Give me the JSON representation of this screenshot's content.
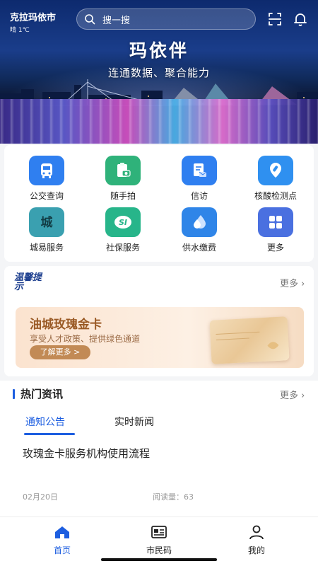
{
  "header": {
    "city": "克拉玛依市",
    "weather": "晴  1℃",
    "search_placeholder": "搜一搜"
  },
  "banner": {
    "title": "玛依伴",
    "subtitle": "连通数据、聚合能力"
  },
  "services": [
    {
      "label": "公交查询",
      "icon": "bus-icon",
      "color": "#2f7ff0"
    },
    {
      "label": "随手拍",
      "icon": "camera-clipboard-icon",
      "color": "#2fb27a"
    },
    {
      "label": "信访",
      "icon": "letter-icon",
      "color": "#2f7ff0"
    },
    {
      "label": "核酸检测点",
      "icon": "test-tube-location-icon",
      "color": "#2f90f0"
    },
    {
      "label": "城易服务",
      "icon": "city-service-icon",
      "color": "#3aa0b0"
    },
    {
      "label": "社保服务",
      "icon": "social-security-icon",
      "color": "#27b58a"
    },
    {
      "label": "供水缴费",
      "icon": "water-drop-icon",
      "color": "#2f85e8"
    },
    {
      "label": "更多",
      "icon": "grid-more-icon",
      "color": "#4a70e0"
    }
  ],
  "tips": {
    "title": "温馨提示",
    "more": "更多",
    "promo": {
      "title": "油城玫瑰金卡",
      "description": "享受人才政策、提供绿色通道",
      "button": "了解更多 >"
    }
  },
  "news": {
    "title": "热门资讯",
    "more": "更多",
    "tabs": [
      "通知公告",
      "实时新闻"
    ],
    "article": {
      "title": "玫瑰金卡服务机构使用流程",
      "date": "02月20日",
      "reads": "阅读量：63"
    }
  },
  "bottom_nav": {
    "items": [
      {
        "label": "首页",
        "icon": "home-icon"
      },
      {
        "label": "市民码",
        "icon": "id-card-icon"
      },
      {
        "label": "我的",
        "icon": "user-icon"
      }
    ],
    "active_color": "#1d5ee0"
  }
}
